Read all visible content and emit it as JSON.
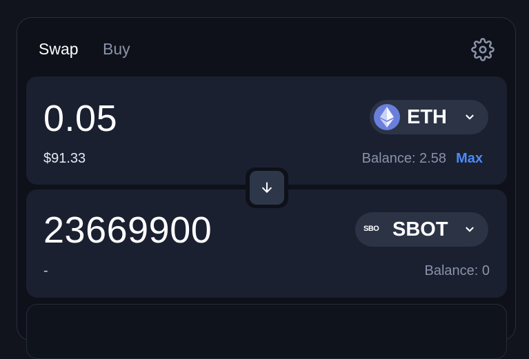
{
  "tabs": [
    {
      "label": "Swap",
      "active": true
    },
    {
      "label": "Buy",
      "active": false
    }
  ],
  "from": {
    "amount": "0.05",
    "fiat_value": "$91.33",
    "balance": "Balance: 2.58",
    "max_label": "Max",
    "token": {
      "symbol": "ETH",
      "icon": "ethereum-icon"
    }
  },
  "to": {
    "amount": "23669900",
    "fiat_value": "-",
    "balance": "Balance: 0",
    "token": {
      "symbol": "SBOT",
      "logo_text": "SBO"
    }
  },
  "icons": {
    "settings": "gear-icon",
    "switch": "arrow-down-icon",
    "dropdown": "chevron-down-icon"
  },
  "colors": {
    "background": "#12141d",
    "card": "#0e1119",
    "panel": "#1a2030",
    "token_button": "#2b3345",
    "accent": "#4b8af6",
    "muted_text": "#8a93ab",
    "eth_logo": "#6a7fdc"
  }
}
